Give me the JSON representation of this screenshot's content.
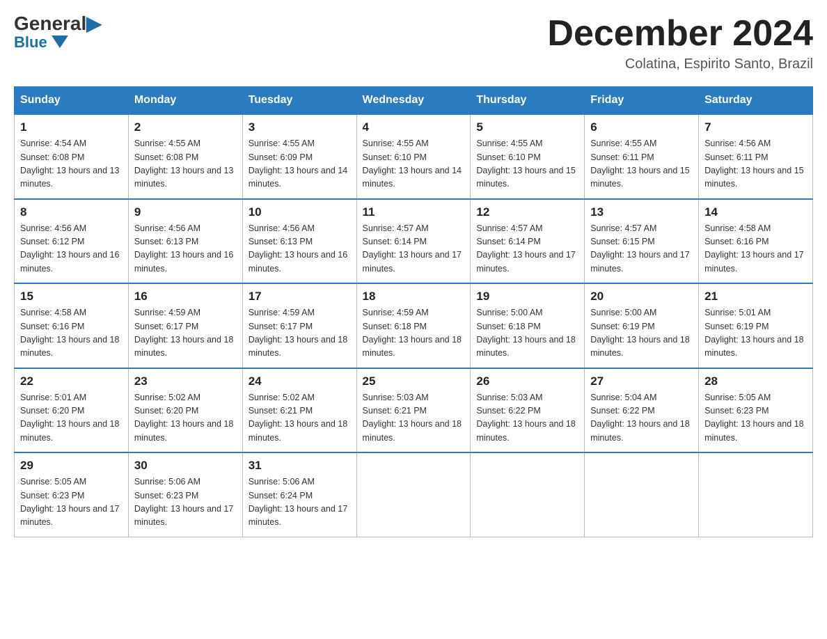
{
  "header": {
    "logo_general": "General",
    "logo_blue": "Blue",
    "month_title": "December 2024",
    "location": "Colatina, Espirito Santo, Brazil"
  },
  "days_of_week": [
    "Sunday",
    "Monday",
    "Tuesday",
    "Wednesday",
    "Thursday",
    "Friday",
    "Saturday"
  ],
  "weeks": [
    [
      {
        "day": "1",
        "sunrise": "4:54 AM",
        "sunset": "6:08 PM",
        "daylight": "13 hours and 13 minutes."
      },
      {
        "day": "2",
        "sunrise": "4:55 AM",
        "sunset": "6:08 PM",
        "daylight": "13 hours and 13 minutes."
      },
      {
        "day": "3",
        "sunrise": "4:55 AM",
        "sunset": "6:09 PM",
        "daylight": "13 hours and 14 minutes."
      },
      {
        "day": "4",
        "sunrise": "4:55 AM",
        "sunset": "6:10 PM",
        "daylight": "13 hours and 14 minutes."
      },
      {
        "day": "5",
        "sunrise": "4:55 AM",
        "sunset": "6:10 PM",
        "daylight": "13 hours and 15 minutes."
      },
      {
        "day": "6",
        "sunrise": "4:55 AM",
        "sunset": "6:11 PM",
        "daylight": "13 hours and 15 minutes."
      },
      {
        "day": "7",
        "sunrise": "4:56 AM",
        "sunset": "6:11 PM",
        "daylight": "13 hours and 15 minutes."
      }
    ],
    [
      {
        "day": "8",
        "sunrise": "4:56 AM",
        "sunset": "6:12 PM",
        "daylight": "13 hours and 16 minutes."
      },
      {
        "day": "9",
        "sunrise": "4:56 AM",
        "sunset": "6:13 PM",
        "daylight": "13 hours and 16 minutes."
      },
      {
        "day": "10",
        "sunrise": "4:56 AM",
        "sunset": "6:13 PM",
        "daylight": "13 hours and 16 minutes."
      },
      {
        "day": "11",
        "sunrise": "4:57 AM",
        "sunset": "6:14 PM",
        "daylight": "13 hours and 17 minutes."
      },
      {
        "day": "12",
        "sunrise": "4:57 AM",
        "sunset": "6:14 PM",
        "daylight": "13 hours and 17 minutes."
      },
      {
        "day": "13",
        "sunrise": "4:57 AM",
        "sunset": "6:15 PM",
        "daylight": "13 hours and 17 minutes."
      },
      {
        "day": "14",
        "sunrise": "4:58 AM",
        "sunset": "6:16 PM",
        "daylight": "13 hours and 17 minutes."
      }
    ],
    [
      {
        "day": "15",
        "sunrise": "4:58 AM",
        "sunset": "6:16 PM",
        "daylight": "13 hours and 18 minutes."
      },
      {
        "day": "16",
        "sunrise": "4:59 AM",
        "sunset": "6:17 PM",
        "daylight": "13 hours and 18 minutes."
      },
      {
        "day": "17",
        "sunrise": "4:59 AM",
        "sunset": "6:17 PM",
        "daylight": "13 hours and 18 minutes."
      },
      {
        "day": "18",
        "sunrise": "4:59 AM",
        "sunset": "6:18 PM",
        "daylight": "13 hours and 18 minutes."
      },
      {
        "day": "19",
        "sunrise": "5:00 AM",
        "sunset": "6:18 PM",
        "daylight": "13 hours and 18 minutes."
      },
      {
        "day": "20",
        "sunrise": "5:00 AM",
        "sunset": "6:19 PM",
        "daylight": "13 hours and 18 minutes."
      },
      {
        "day": "21",
        "sunrise": "5:01 AM",
        "sunset": "6:19 PM",
        "daylight": "13 hours and 18 minutes."
      }
    ],
    [
      {
        "day": "22",
        "sunrise": "5:01 AM",
        "sunset": "6:20 PM",
        "daylight": "13 hours and 18 minutes."
      },
      {
        "day": "23",
        "sunrise": "5:02 AM",
        "sunset": "6:20 PM",
        "daylight": "13 hours and 18 minutes."
      },
      {
        "day": "24",
        "sunrise": "5:02 AM",
        "sunset": "6:21 PM",
        "daylight": "13 hours and 18 minutes."
      },
      {
        "day": "25",
        "sunrise": "5:03 AM",
        "sunset": "6:21 PM",
        "daylight": "13 hours and 18 minutes."
      },
      {
        "day": "26",
        "sunrise": "5:03 AM",
        "sunset": "6:22 PM",
        "daylight": "13 hours and 18 minutes."
      },
      {
        "day": "27",
        "sunrise": "5:04 AM",
        "sunset": "6:22 PM",
        "daylight": "13 hours and 18 minutes."
      },
      {
        "day": "28",
        "sunrise": "5:05 AM",
        "sunset": "6:23 PM",
        "daylight": "13 hours and 18 minutes."
      }
    ],
    [
      {
        "day": "29",
        "sunrise": "5:05 AM",
        "sunset": "6:23 PM",
        "daylight": "13 hours and 17 minutes."
      },
      {
        "day": "30",
        "sunrise": "5:06 AM",
        "sunset": "6:23 PM",
        "daylight": "13 hours and 17 minutes."
      },
      {
        "day": "31",
        "sunrise": "5:06 AM",
        "sunset": "6:24 PM",
        "daylight": "13 hours and 17 minutes."
      },
      null,
      null,
      null,
      null
    ]
  ],
  "labels": {
    "sunrise_prefix": "Sunrise: ",
    "sunset_prefix": "Sunset: ",
    "daylight_prefix": "Daylight: "
  }
}
